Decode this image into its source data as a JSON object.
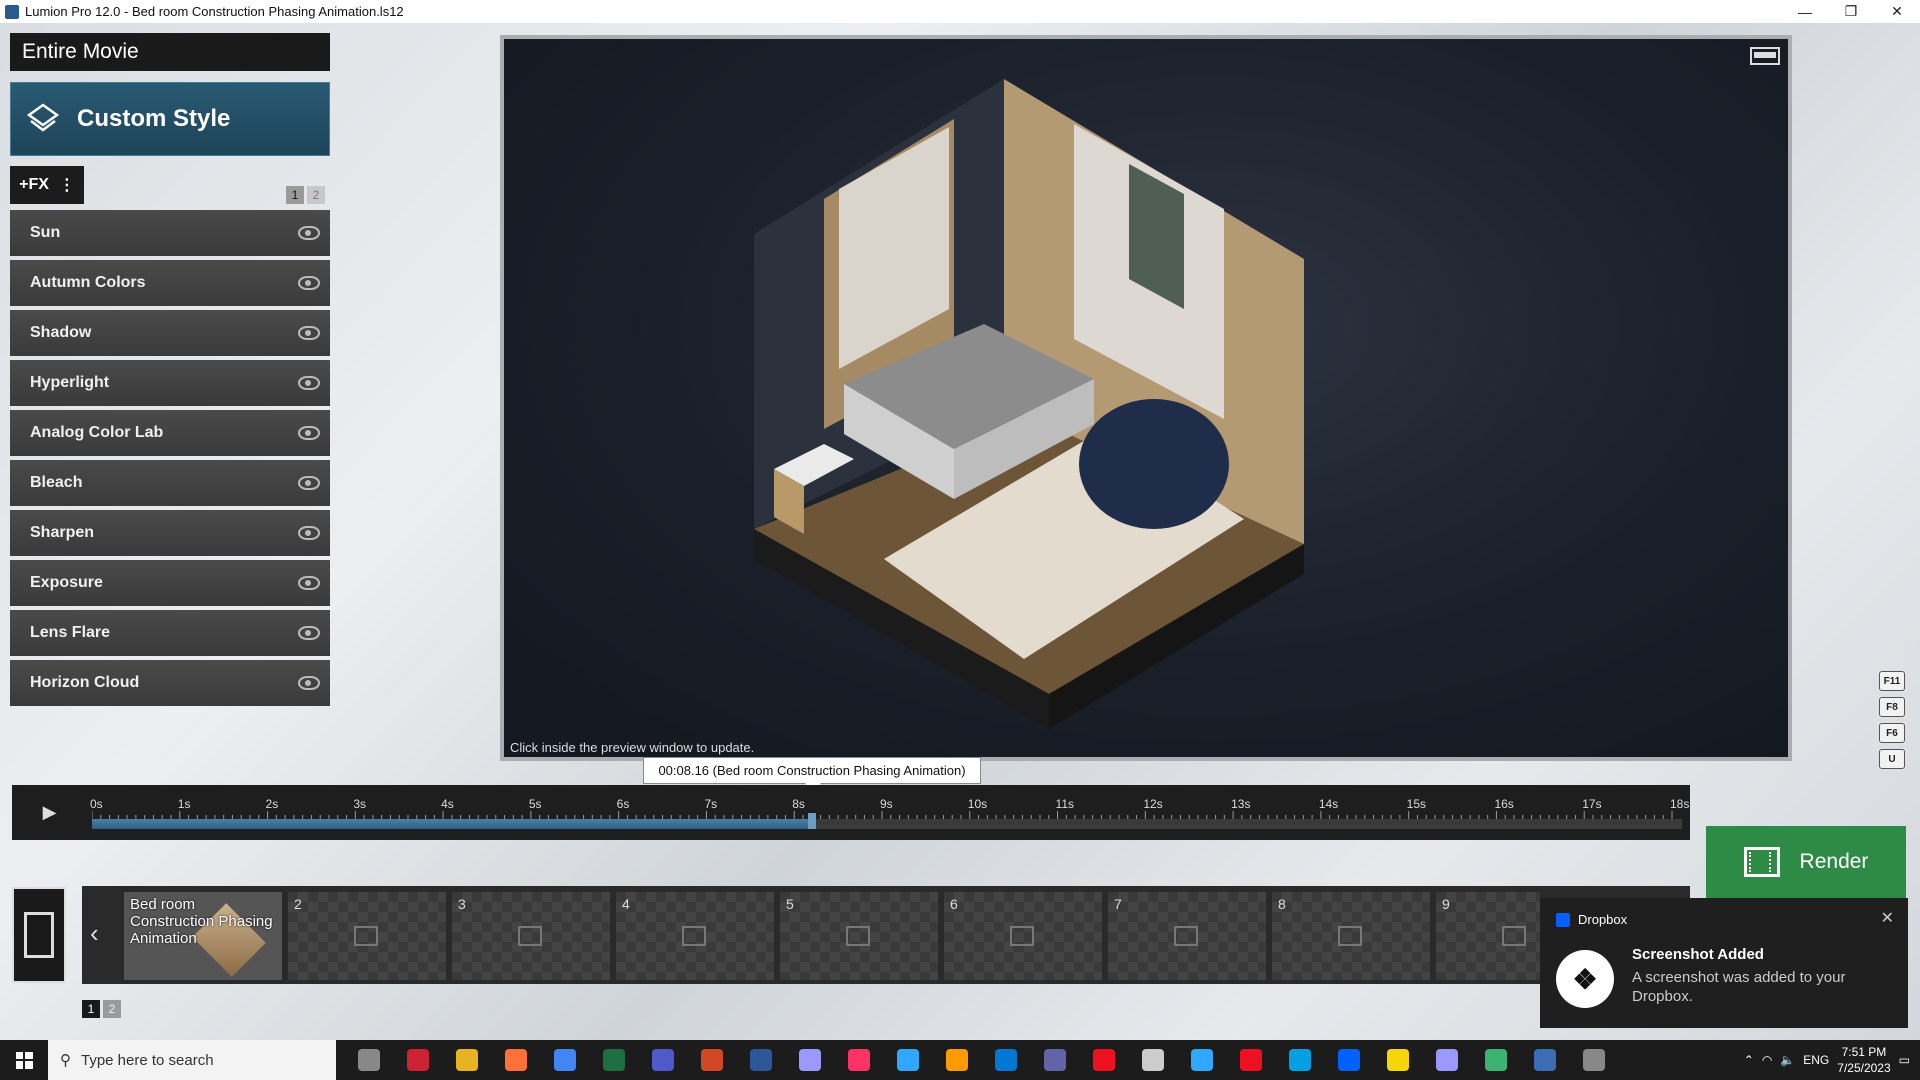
{
  "window": {
    "title": "Lumion Pro 12.0  - Bed room Construction Phasing Animation.ls12"
  },
  "left_panel": {
    "movie_label": "Entire Movie",
    "style_title": "Custom Style",
    "fx_button": "+FX",
    "pages": [
      "1",
      "2"
    ],
    "effects": [
      "Sun",
      "Autumn Colors",
      "Shadow",
      "Hyperlight",
      "Analog Color Lab",
      "Bleach",
      "Sharpen",
      "Exposure",
      "Lens Flare",
      "Horizon Cloud"
    ]
  },
  "preview": {
    "hint": "Click inside the preview window to update.",
    "side_keys": [
      "F11",
      "F8",
      "F6",
      "U"
    ]
  },
  "timeline": {
    "tooltip": "00:08.16 (Bed room Construction Phasing Animation)",
    "ticks": [
      "0s",
      "1s",
      "2s",
      "3s",
      "4s",
      "5s",
      "6s",
      "7s",
      "8s",
      "9s",
      "10s",
      "11s",
      "12s",
      "13s",
      "14s",
      "15s",
      "16s",
      "17s",
      "18s"
    ],
    "progress_fraction": 0.453
  },
  "render_button": "Render",
  "clips": {
    "first_title": "Bed room Construction Phasing Animation",
    "numbers": [
      "2",
      "3",
      "4",
      "5",
      "6",
      "7",
      "8",
      "9"
    ],
    "pages": [
      "1",
      "2"
    ]
  },
  "notification": {
    "source": "Dropbox",
    "heading": "Screenshot Added",
    "body": "A screenshot was added to your Dropbox."
  },
  "taskbar": {
    "search_placeholder": "Type here to search",
    "language": "ENG",
    "time": "7:51 PM",
    "date": "7/25/2023",
    "app_icons": [
      "task-view",
      "sharepoint",
      "file-explorer",
      "firefox",
      "chrome",
      "excel",
      "teams",
      "powerpoint",
      "word",
      "after-effects",
      "indesign",
      "photoshop",
      "illustrator",
      "edge",
      "teams-2",
      "acrobat",
      "unknown",
      "photoshop-2",
      "autocad",
      "sketchup",
      "dropbox-app",
      "sticky-notes",
      "premiere",
      "qgis",
      "lumion",
      "notion"
    ]
  },
  "colors": {
    "accent_style": "#2a5a73",
    "render_green": "#2e8b45",
    "timeline_fill": "#4d7ea3"
  }
}
